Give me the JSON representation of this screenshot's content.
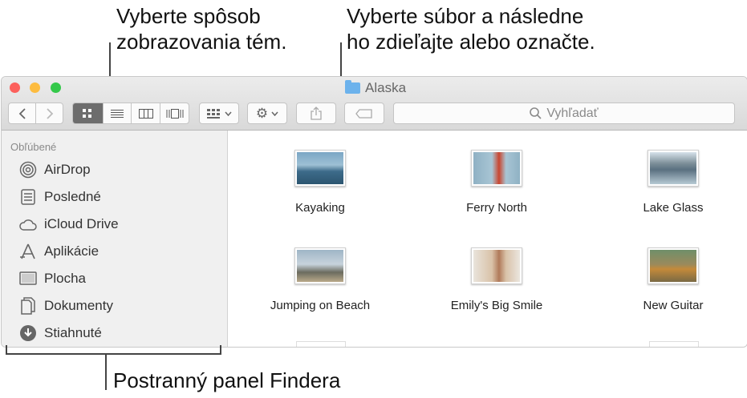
{
  "callouts": {
    "view": "Vyberte spôsob\nzobrazovania tém.",
    "share": "Vyberte súbor a následne\nho zdieľajte alebo označte.",
    "sidebar": "Postranný panel Findera"
  },
  "window": {
    "title": "Alaska"
  },
  "toolbar": {
    "search_placeholder": "Vyhľadať"
  },
  "sidebar": {
    "heading": "Obľúbené",
    "items": [
      {
        "label": "AirDrop",
        "icon": "airdrop-icon"
      },
      {
        "label": "Posledné",
        "icon": "recents-icon"
      },
      {
        "label": "iCloud Drive",
        "icon": "cloud-icon"
      },
      {
        "label": "Aplikácie",
        "icon": "applications-icon"
      },
      {
        "label": "Plocha",
        "icon": "desktop-icon"
      },
      {
        "label": "Dokumenty",
        "icon": "documents-icon"
      },
      {
        "label": "Stiahnuté",
        "icon": "downloads-icon"
      }
    ]
  },
  "files": [
    {
      "name": "Kayaking"
    },
    {
      "name": "Ferry North"
    },
    {
      "name": "Lake Glass"
    },
    {
      "name": "Jumping on Beach"
    },
    {
      "name": "Emily's Big Smile"
    },
    {
      "name": "New Guitar"
    }
  ],
  "colors": {
    "close": "#fc605c",
    "minimize": "#fdbc40",
    "zoom": "#34c84a",
    "active_segment": "#6d6d6d"
  }
}
